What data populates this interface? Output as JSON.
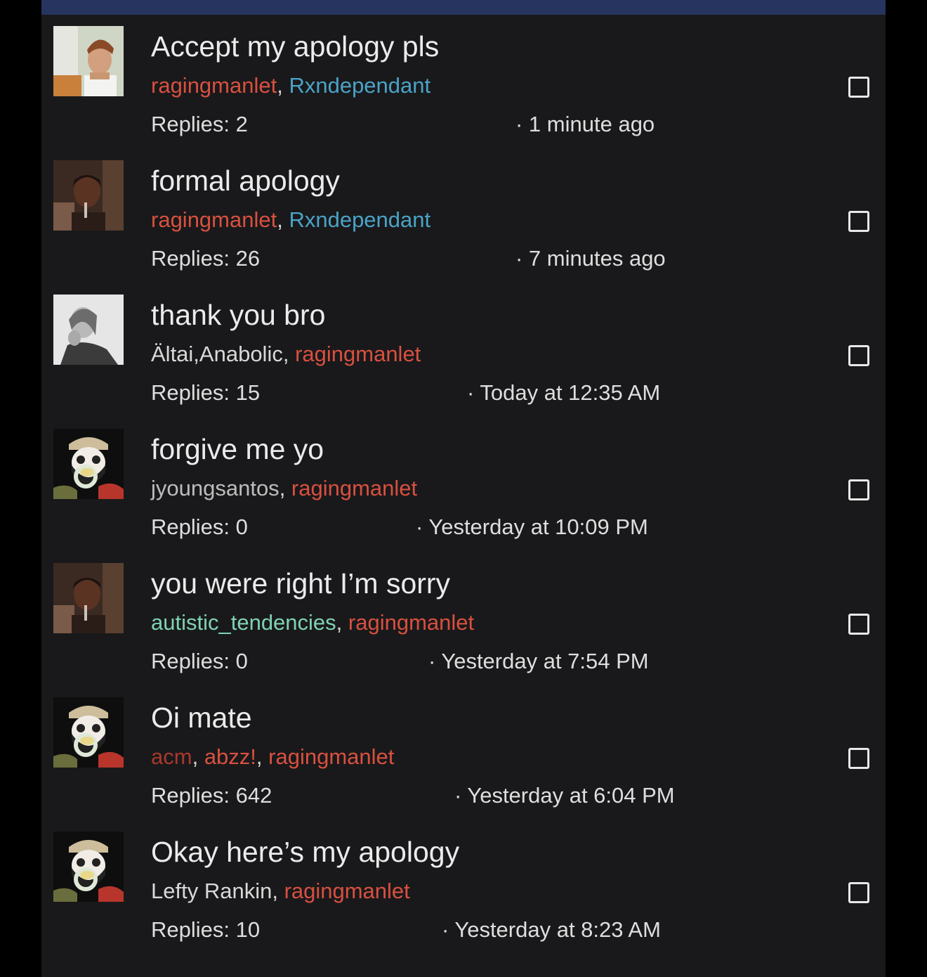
{
  "colors": {
    "header_bar": "#26345f",
    "background": "#19191b",
    "user_red": "#d9503f",
    "user_blue": "#4aa3c6",
    "user_green": "#7fd2b2",
    "user_darkred": "#a8382b",
    "user_gray": "#bdbdbd",
    "user_white": "#d8d8d8"
  },
  "conversations": [
    {
      "title": "Accept my apology pls",
      "avatar_icon": "avatar-man-smiling",
      "participants": [
        {
          "name": "ragingmanlet",
          "color": "#d9503f"
        },
        {
          "name": "Rxndependant",
          "color": "#4aa3c6"
        }
      ],
      "replies": "Replies: 2",
      "time": "· 1 minute ago"
    },
    {
      "title": "formal apology",
      "avatar_icon": "avatar-man-portrait",
      "participants": [
        {
          "name": "ragingmanlet",
          "color": "#d9503f"
        },
        {
          "name": "Rxndependant",
          "color": "#4aa3c6"
        }
      ],
      "replies": "Replies: 26",
      "time": "· 7 minutes ago"
    },
    {
      "title": "thank you bro",
      "avatar_icon": "avatar-woman-bw",
      "participants": [
        {
          "name": "Ältai,Anabolic",
          "color": "#d8d8d8"
        },
        {
          "name": "ragingmanlet",
          "color": "#d9503f"
        }
      ],
      "replies": "Replies: 15",
      "time": "· Today at 12:35 AM"
    },
    {
      "title": "forgive me yo",
      "avatar_icon": "avatar-cartoon-pacifier",
      "participants": [
        {
          "name": "jyoungsantos",
          "color": "#bdbdbd"
        },
        {
          "name": "ragingmanlet",
          "color": "#d9503f"
        }
      ],
      "replies": "Replies: 0",
      "time": "· Yesterday at 10:09 PM"
    },
    {
      "title": "you were right I’m sorry",
      "avatar_icon": "avatar-man-portrait",
      "participants": [
        {
          "name": "autistic_tendencies",
          "color": "#7fd2b2"
        },
        {
          "name": "ragingmanlet",
          "color": "#d9503f"
        }
      ],
      "replies": "Replies: 0",
      "time": "· Yesterday at 7:54 PM"
    },
    {
      "title": "Oi mate",
      "avatar_icon": "avatar-cartoon-pacifier",
      "participants": [
        {
          "name": "acm",
          "color": "#a8382b"
        },
        {
          "name": "abzz!",
          "color": "#d9503f"
        },
        {
          "name": "ragingmanlet",
          "color": "#d9503f"
        }
      ],
      "replies": "Replies: 642",
      "time": "· Yesterday at 6:04 PM"
    },
    {
      "title": "Okay here’s my apology",
      "avatar_icon": "avatar-cartoon-pacifier",
      "participants": [
        {
          "name": "Lefty Rankin",
          "color": "#d8d8d8"
        },
        {
          "name": "ragingmanlet",
          "color": "#d9503f"
        }
      ],
      "replies": "Replies: 10",
      "time": "· Yesterday at 8:23 AM"
    }
  ]
}
